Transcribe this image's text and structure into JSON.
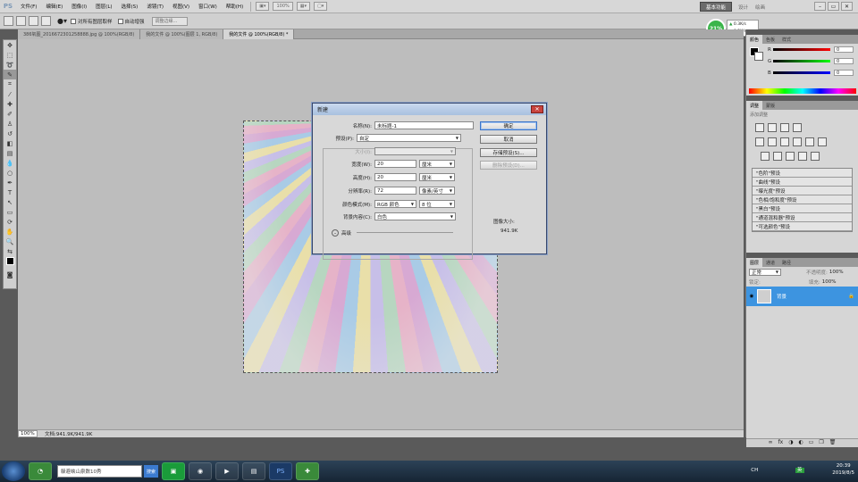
{
  "app": {
    "logo": "PS"
  },
  "menubar": {
    "items": [
      "文件(F)",
      "编辑(E)",
      "图像(I)",
      "图层(L)",
      "选择(S)",
      "滤镜(T)",
      "视图(V)",
      "窗口(W)",
      "帮助(H)"
    ],
    "zoom_value": "100%",
    "workspace_active": "基本功能",
    "workspace_links": [
      "设计",
      "绘画"
    ]
  },
  "options_bar": {
    "checkbox_all_layers": "对所有图层取样",
    "checkbox_auto_enhance": "自动增强",
    "refine_edge_button": "调整边缘..."
  },
  "doc_tabs": [
    {
      "label": "386氧图_2016672301258888.jpg @ 100%(RGB/8)",
      "active": false
    },
    {
      "label": "我的文件 @ 100%(图层 1, RGB/8)",
      "active": false
    },
    {
      "label": "我的文件 @ 100%(RGB/8) *",
      "active": true
    }
  ],
  "memory_widget": {
    "percent": "21%",
    "up": "0.3K/s",
    "down": "0.2K/s"
  },
  "status_bar": {
    "zoom": "100%",
    "doc_info": "文档:941.9K/941.9K"
  },
  "color_panel": {
    "tabs": [
      "颜色",
      "色板",
      "样式"
    ],
    "channels": [
      {
        "name": "R",
        "value": "0"
      },
      {
        "name": "G",
        "value": "0"
      },
      {
        "name": "B",
        "value": "0"
      }
    ]
  },
  "adjustments_panel": {
    "tabs": [
      "调整",
      "蒙版"
    ],
    "subtitle": "添加调整",
    "presets": [
      "\"色阶\"预设",
      "\"曲线\"预设",
      "\"曝光度\"预设",
      "\"色相/饱和度\"预设",
      "\"黑白\"预设",
      "\"通道混和器\"预设",
      "\"可选颜色\"预设"
    ]
  },
  "layers_panel": {
    "tabs": [
      "图层",
      "通道",
      "路径"
    ],
    "blend_mode": "正常",
    "opacity_label": "不透明度:",
    "opacity_value": "100%",
    "lock_label": "锁定:",
    "fill_label": "填充:",
    "fill_value": "100%",
    "layer_name": "背景"
  },
  "dialog": {
    "title": "新建",
    "name_label": "名称(N):",
    "name_value": "未标题-1",
    "preset_label": "预设(P):",
    "preset_value": "自定",
    "size_label": "大小(I):",
    "width_label": "宽度(W):",
    "width_value": "20",
    "width_unit": "厘米",
    "height_label": "高度(H):",
    "height_value": "20",
    "height_unit": "厘米",
    "resolution_label": "分辨率(R):",
    "resolution_value": "72",
    "resolution_unit": "像素/英寸",
    "color_mode_label": "颜色模式(M):",
    "color_mode_value": "RGB 颜色",
    "bit_depth": "8 位",
    "bg_label": "背景内容(C):",
    "bg_value": "白色",
    "advanced_label": "高级",
    "ok_button": "确定",
    "cancel_button": "取消",
    "save_preset_button": "存储预设(S)...",
    "delete_preset_button": "删除预设(D)...",
    "image_size_label": "图像大小:",
    "image_size_value": "941.9K"
  },
  "taskbar": {
    "ie_search_placeholder": "躲避峡山泉数10秀",
    "ie_search_button": "搜索",
    "app_labels": [
      "PS"
    ],
    "ime": "CH",
    "ime2": "英",
    "time": "20:39",
    "date": "2019/8/5"
  },
  "colors": {
    "accent": "#3d94e0",
    "titlebar": "#a8c0df",
    "close": "#c8433d"
  }
}
